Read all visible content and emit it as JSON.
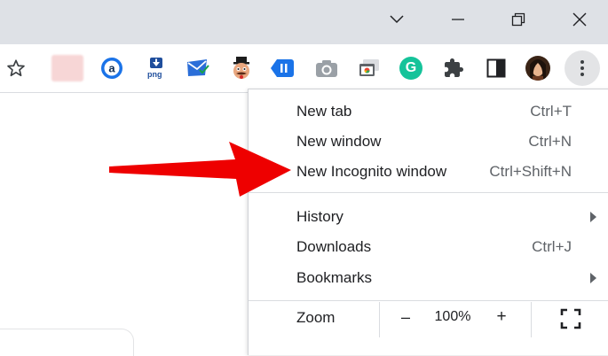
{
  "colors": {
    "titlebar_bg": "#dee1e6",
    "menu_text": "#202124",
    "shortcut_text": "#5f6368",
    "annotation_arrow": "#ee0000",
    "grammarly_green": "#15c39a",
    "blue_accent": "#1a73e8"
  },
  "window_controls": [
    {
      "icon": "chevron-down-icon"
    },
    {
      "icon": "minimize-icon"
    },
    {
      "icon": "restore-icon"
    },
    {
      "icon": "close-icon"
    }
  ],
  "toolbar": {
    "bookmark_star_icon": "star-icon",
    "extensions": [
      {
        "name": "blurred-extension-icon"
      },
      {
        "name": "amazon-assistant-icon"
      },
      {
        "name": "save-as-png-extension-icon",
        "label": "png"
      },
      {
        "name": "mailtrack-extension-icon"
      },
      {
        "name": "mascot-extension-icon"
      },
      {
        "name": "clipboard-extension-icon"
      },
      {
        "name": "camera-extension-icon"
      },
      {
        "name": "cast-extension-icon"
      },
      {
        "name": "grammarly-extension-icon",
        "label": "G"
      },
      {
        "name": "puzzle-extensions-icon"
      },
      {
        "name": "side-panel-icon"
      },
      {
        "name": "profile-avatar"
      }
    ],
    "menu_icon": "vertical-dots-icon"
  },
  "menu": {
    "items": [
      {
        "label": "New tab",
        "shortcut": "Ctrl+T",
        "submenu": false
      },
      {
        "label": "New window",
        "shortcut": "Ctrl+N",
        "submenu": false
      },
      {
        "label": "New Incognito window",
        "shortcut": "Ctrl+Shift+N",
        "submenu": false
      },
      {
        "label": "History",
        "shortcut": "",
        "submenu": true
      },
      {
        "label": "Downloads",
        "shortcut": "Ctrl+J",
        "submenu": false
      },
      {
        "label": "Bookmarks",
        "shortcut": "",
        "submenu": true
      }
    ],
    "zoom": {
      "label": "Zoom",
      "minus": "–",
      "value": "100%",
      "plus": "+",
      "fullscreen_icon": "fullscreen-icon"
    }
  }
}
